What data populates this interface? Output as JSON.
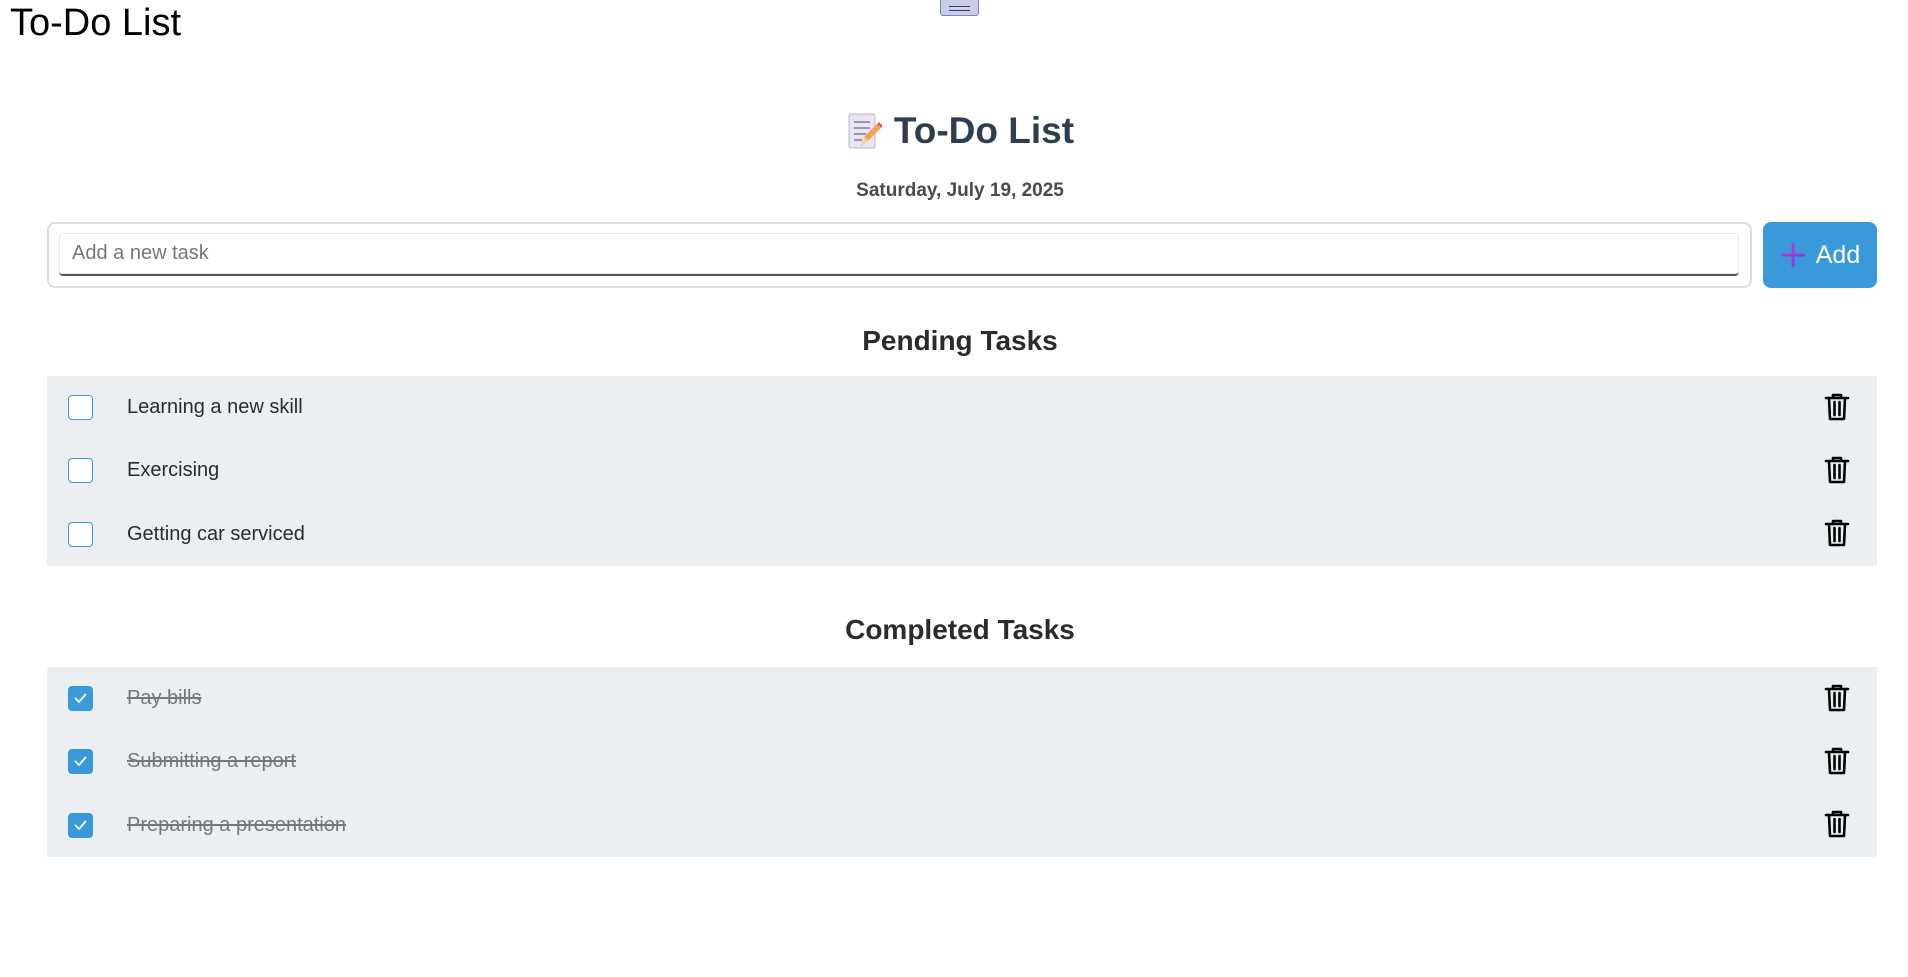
{
  "window": {
    "title": "To-Do List"
  },
  "app": {
    "title": "To-Do List",
    "title_icon": "memo-icon",
    "date": "Saturday, July 19, 2025"
  },
  "new_task": {
    "placeholder": "Add a new task",
    "value": "",
    "add_label": "Add",
    "add_icon": "plus-icon"
  },
  "pending": {
    "heading": "Pending Tasks",
    "tasks": [
      {
        "label": "Learning a new skill",
        "checked": false
      },
      {
        "label": "Exercising",
        "checked": false
      },
      {
        "label": "Getting car serviced",
        "checked": false
      }
    ]
  },
  "completed": {
    "heading": "Completed Tasks",
    "tasks": [
      {
        "label": "Pay bills",
        "checked": true
      },
      {
        "label": "Submitting a report",
        "checked": true
      },
      {
        "label": "Preparing a presentation",
        "checked": true
      }
    ]
  },
  "colors": {
    "accent": "#3a9ad9",
    "title": "#2c3e50",
    "list_background": "#ebeff1"
  }
}
